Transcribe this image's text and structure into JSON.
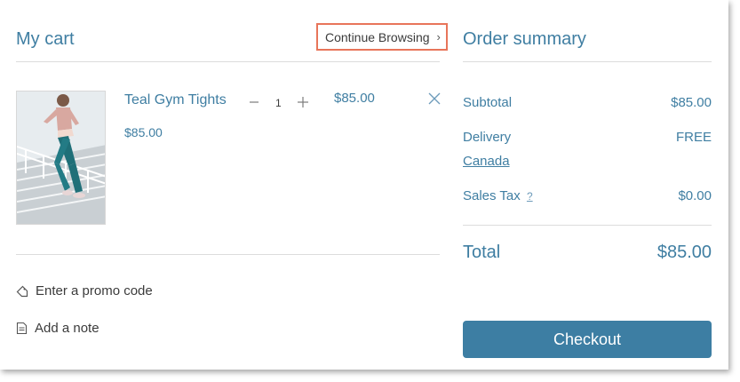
{
  "cart": {
    "title": "My cart",
    "continue_label": "Continue Browsing",
    "item": {
      "name": "Teal Gym Tights",
      "unit_price": "$85.00",
      "quantity": "1",
      "line_total": "$85.00"
    },
    "promo_label": "Enter a promo code",
    "note_label": "Add a note"
  },
  "summary": {
    "title": "Order summary",
    "subtotal_label": "Subtotal",
    "subtotal_value": "$85.00",
    "delivery_label": "Delivery",
    "delivery_value": "FREE",
    "delivery_location": "Canada",
    "tax_label": "Sales Tax",
    "tax_help": "?",
    "tax_value": "$0.00",
    "total_label": "Total",
    "total_value": "$85.00",
    "checkout_label": "Checkout"
  },
  "colors": {
    "accent": "#3f7ea2",
    "button": "#3d7ea3",
    "highlight_border": "#e8755a"
  },
  "icons": [
    "chevron-right-icon",
    "close-icon",
    "tag-icon",
    "note-icon",
    "minus-icon",
    "plus-icon"
  ]
}
